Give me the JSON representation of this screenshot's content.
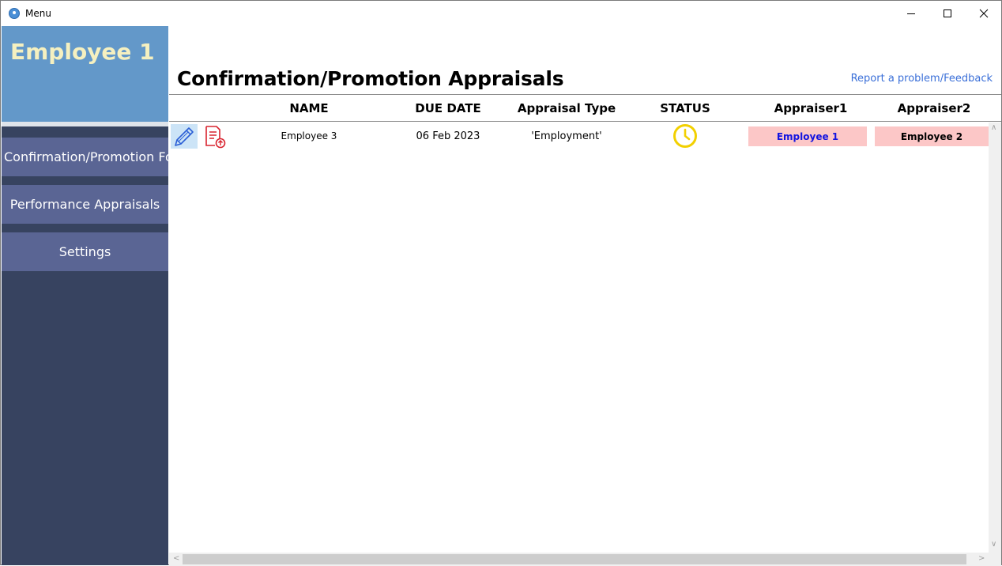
{
  "window": {
    "title": "Menu"
  },
  "sidebar": {
    "user_name": "Employee 1",
    "items": [
      {
        "label": "Confirmation/Promotion Form"
      },
      {
        "label": "Performance Appraisals"
      },
      {
        "label": "Settings"
      }
    ]
  },
  "main": {
    "title": "Confirmation/Promotion Appraisals",
    "feedback_link": "Report a problem/Feedback",
    "columns": [
      "NAME",
      "DUE DATE",
      "Appraisal Type",
      "STATUS",
      "Appraiser1",
      "Appraiser2"
    ],
    "rows": [
      {
        "name": "Employee 3",
        "due_date": "06 Feb 2023",
        "appraisal_type": "'Employment'",
        "status_icon": "clock-icon",
        "appraiser1": "Employee 1",
        "appraiser2": "Employee 2"
      }
    ]
  },
  "colors": {
    "sidebar_bg": "#374360",
    "banner_bg": "#6398c9",
    "nav_item_bg": "#5a6594",
    "user_name": "#f5f0c0",
    "link": "#3a6fd8",
    "appraiser_bg": "#fcc7c7",
    "appraiser1_text": "#1414e0",
    "status_pending": "#f2d000",
    "doc_icon": "#d9232f"
  }
}
